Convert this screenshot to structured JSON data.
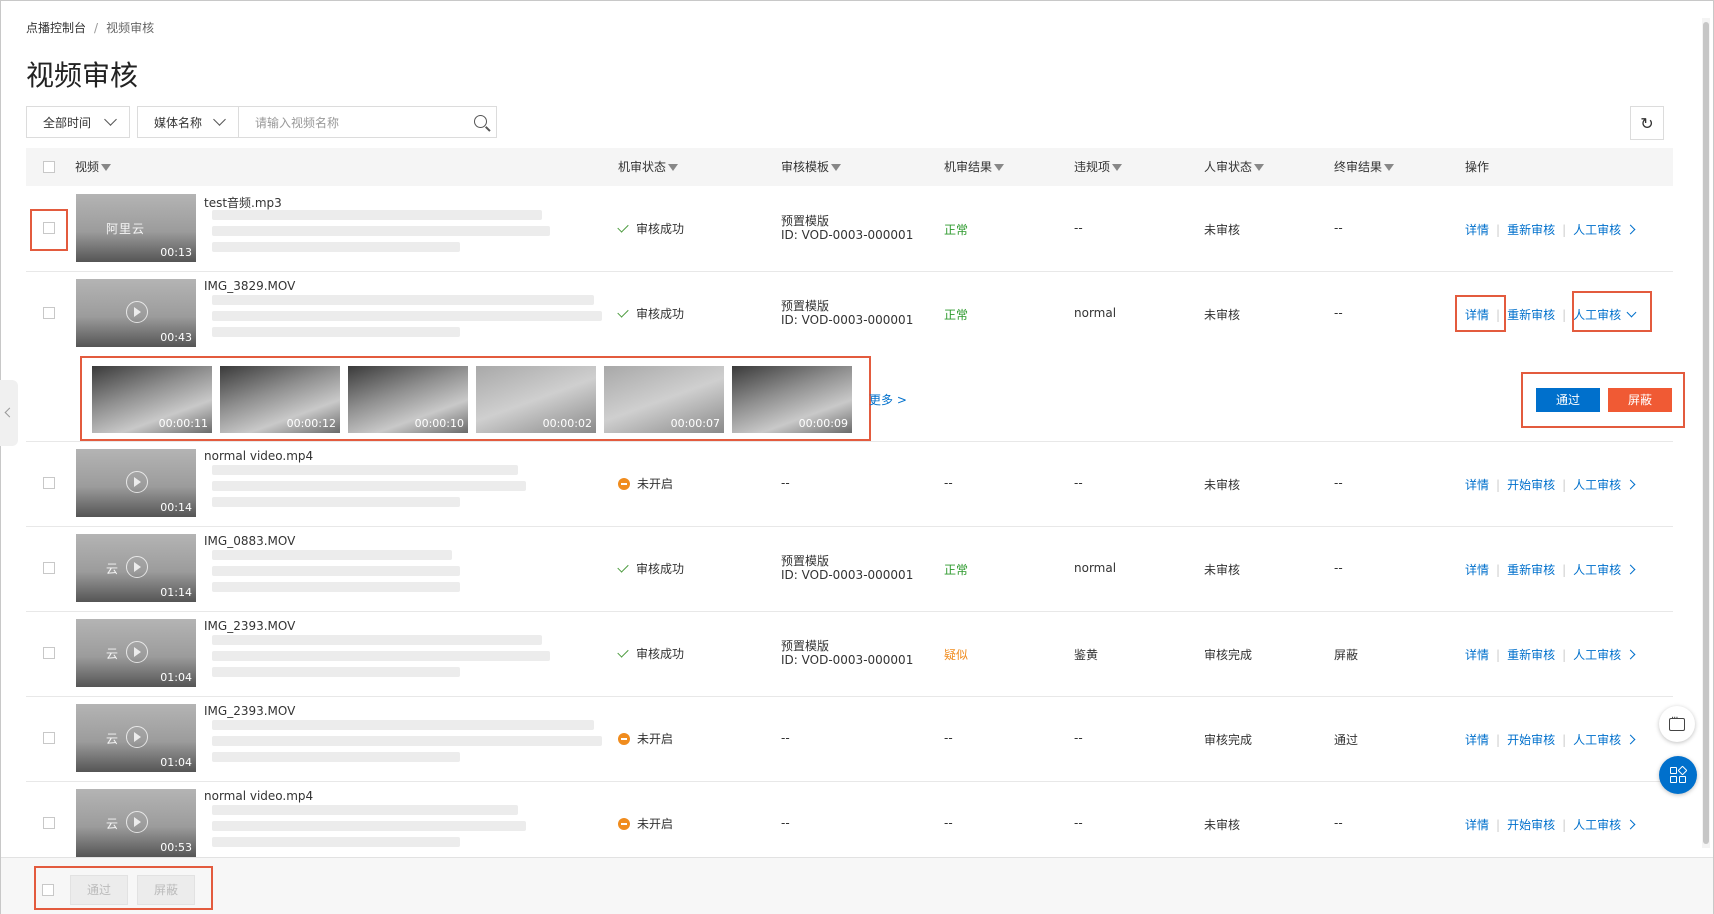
{
  "breadcrumb": {
    "parent": "点播控制台",
    "separator": "/",
    "current": "视频审核"
  },
  "page_title": "视频审核",
  "filters": {
    "time_select": "全部时间",
    "field_select": "媒体名称",
    "search_placeholder": "请输入视频名称"
  },
  "icons": {
    "refresh": "refresh-icon",
    "search": "search-icon",
    "filter": "filter-icon",
    "success": "check-icon",
    "not_started": "minus-circle-icon",
    "chat": "chat-icon",
    "apps": "apps-icon"
  },
  "table": {
    "headers": {
      "video": "视频",
      "machine_status": "机审状态",
      "template": "审核模板",
      "machine_result": "机审结果",
      "violation": "违规项",
      "human_status": "人审状态",
      "final_result": "终审结果",
      "actions": "操作"
    },
    "rows": [
      {
        "name": "test音频.mp3",
        "duration": "00:13",
        "logo_text": "阿里云",
        "machine_status": "审核成功",
        "machine_status_type": "success",
        "template_name": "预置模版",
        "template_id": "ID: VOD-0003-000001",
        "machine_result": "正常",
        "machine_result_color": "green",
        "violation": "--",
        "human_status": "未审核",
        "final_result": "--",
        "action_detail": "详情",
        "action_review": "重新审核",
        "action_manual": "人工审核",
        "expanded": false
      },
      {
        "name": "IMG_3829.MOV",
        "duration": "00:43",
        "logo_text": "",
        "machine_status": "审核成功",
        "machine_status_type": "success",
        "template_name": "预置模版",
        "template_id": "ID: VOD-0003-000001",
        "machine_result": "正常",
        "machine_result_color": "green",
        "violation": "normal",
        "human_status": "未审核",
        "final_result": "--",
        "action_detail": "详情",
        "action_review": "重新审核",
        "action_manual": "人工审核",
        "expanded": true
      },
      {
        "name": "normal video.mp4",
        "duration": "00:14",
        "logo_text": "",
        "machine_status": "未开启",
        "machine_status_type": "not_started",
        "template_name": "--",
        "template_id": "",
        "machine_result": "--",
        "machine_result_color": "normal",
        "violation": "--",
        "human_status": "未审核",
        "final_result": "--",
        "action_detail": "详情",
        "action_review": "开始审核",
        "action_manual": "人工审核",
        "expanded": false
      },
      {
        "name": "IMG_0883.MOV",
        "duration": "01:14",
        "logo_text": "云",
        "machine_status": "审核成功",
        "machine_status_type": "success",
        "template_name": "预置模版",
        "template_id": "ID: VOD-0003-000001",
        "machine_result": "正常",
        "machine_result_color": "green",
        "violation": "normal",
        "human_status": "未审核",
        "final_result": "--",
        "action_detail": "详情",
        "action_review": "重新审核",
        "action_manual": "人工审核",
        "expanded": false
      },
      {
        "name": "IMG_2393.MOV",
        "duration": "01:04",
        "logo_text": "云",
        "machine_status": "审核成功",
        "machine_status_type": "success",
        "template_name": "预置模版",
        "template_id": "ID: VOD-0003-000001",
        "machine_result": "疑似",
        "machine_result_color": "orange",
        "violation": "鉴黄",
        "human_status": "审核完成",
        "final_result": "屏蔽",
        "action_detail": "详情",
        "action_review": "重新审核",
        "action_manual": "人工审核",
        "expanded": false
      },
      {
        "name": "IMG_2393.MOV",
        "duration": "01:04",
        "logo_text": "云",
        "machine_status": "未开启",
        "machine_status_type": "not_started",
        "template_name": "--",
        "template_id": "",
        "machine_result": "--",
        "machine_result_color": "normal",
        "violation": "--",
        "human_status": "审核完成",
        "final_result": "通过",
        "action_detail": "详情",
        "action_review": "开始审核",
        "action_manual": "人工审核",
        "expanded": false
      },
      {
        "name": "normal video.mp4",
        "duration": "00:53",
        "logo_text": "云",
        "machine_status": "未开启",
        "machine_status_type": "not_started",
        "template_name": "--",
        "template_id": "",
        "machine_result": "--",
        "machine_result_color": "normal",
        "violation": "--",
        "human_status": "未审核",
        "final_result": "--",
        "action_detail": "详情",
        "action_review": "开始审核",
        "action_manual": "人工审核",
        "expanded": false
      }
    ]
  },
  "expanded_panel": {
    "frame_timestamps": [
      "00:00:11",
      "00:00:12",
      "00:00:10",
      "00:00:02",
      "00:00:07",
      "00:00:09"
    ],
    "more_label": "更多 >",
    "pass_label": "通过",
    "block_label": "屏蔽"
  },
  "footer": {
    "pass_label": "通过",
    "block_label": "屏蔽"
  },
  "colors": {
    "link": "#0070cc",
    "pass_button": "#0070cc",
    "block_button": "#f05a34",
    "highlight": "#e35b3e",
    "normal_result": "#2d9a2d",
    "suspect_result": "#f08c1e"
  }
}
